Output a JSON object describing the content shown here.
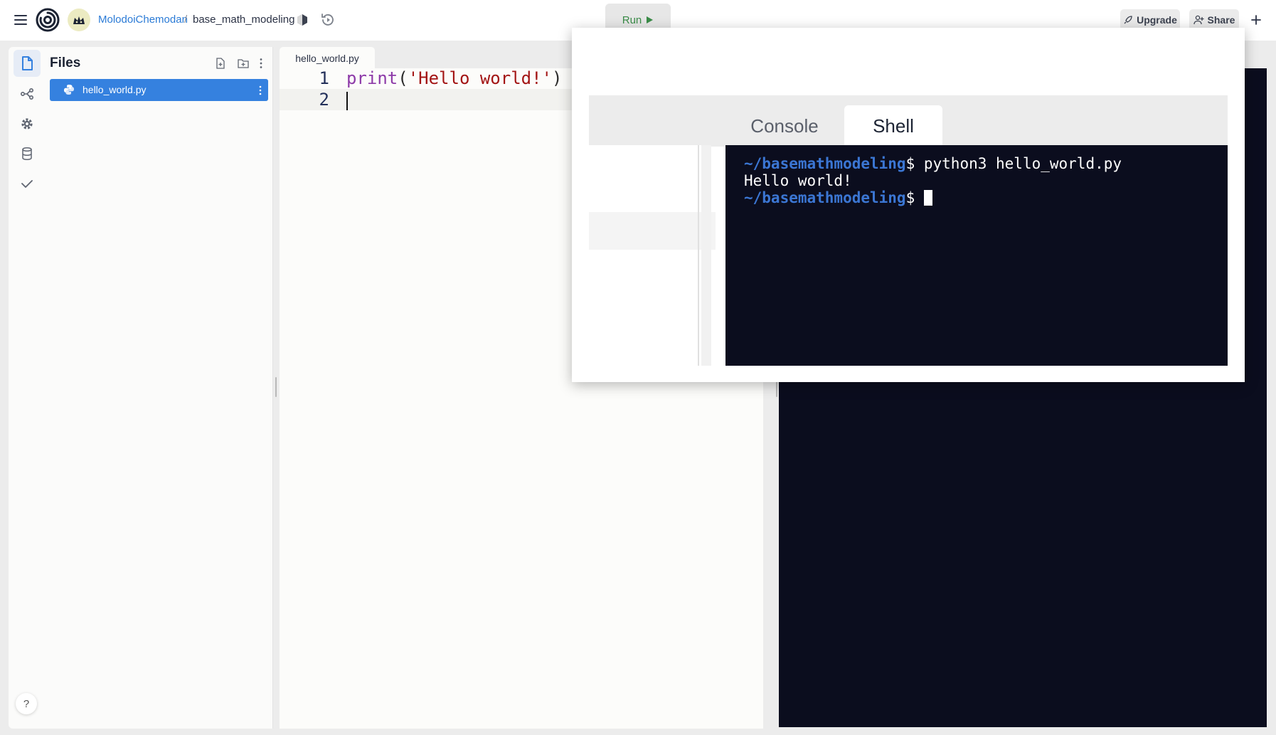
{
  "header": {
    "owner": "MolodoiChemodan",
    "separator": "/",
    "repl_name": "base_math_modeling",
    "run_label": "Run",
    "upgrade_label": "Upgrade",
    "share_label": "Share"
  },
  "files": {
    "title": "Files",
    "items": [
      {
        "name": "hello_world.py",
        "selected": true
      }
    ]
  },
  "editor": {
    "tab_label": "hello_world.py",
    "lines": [
      {
        "number": "1",
        "tokens": [
          "print",
          "(",
          "'Hello world!'",
          ")"
        ]
      },
      {
        "number": "2",
        "tokens": []
      }
    ]
  },
  "zoom": {
    "tabs": [
      {
        "label": "Console",
        "active": false
      },
      {
        "label": "Shell",
        "active": true
      }
    ],
    "terminal": {
      "lines": [
        {
          "path": "~/basemathmodeling",
          "prompt": "$ ",
          "command": "python3 hello_world.py"
        },
        {
          "output": "Hello world!"
        },
        {
          "path": "~/basemathmodeling",
          "prompt": "$ ",
          "command": ""
        }
      ]
    }
  },
  "help_label": "?",
  "colors": {
    "accent": "#3581df",
    "run_green": "#3a8c48",
    "terminal_bg": "#0b0d1e",
    "terminal_path": "#3b76d3"
  },
  "icons": [
    "menu-icon",
    "replit-logo",
    "avatar-icon",
    "python-language-icon",
    "history-icon",
    "play-icon",
    "rocket-icon",
    "add-person-icon",
    "plus-icon",
    "file-icon",
    "git-branch-icon",
    "gear-icon",
    "database-icon",
    "checkmark-icon",
    "new-file-icon",
    "new-folder-icon",
    "kebab-menu-icon",
    "python-file-icon"
  ]
}
